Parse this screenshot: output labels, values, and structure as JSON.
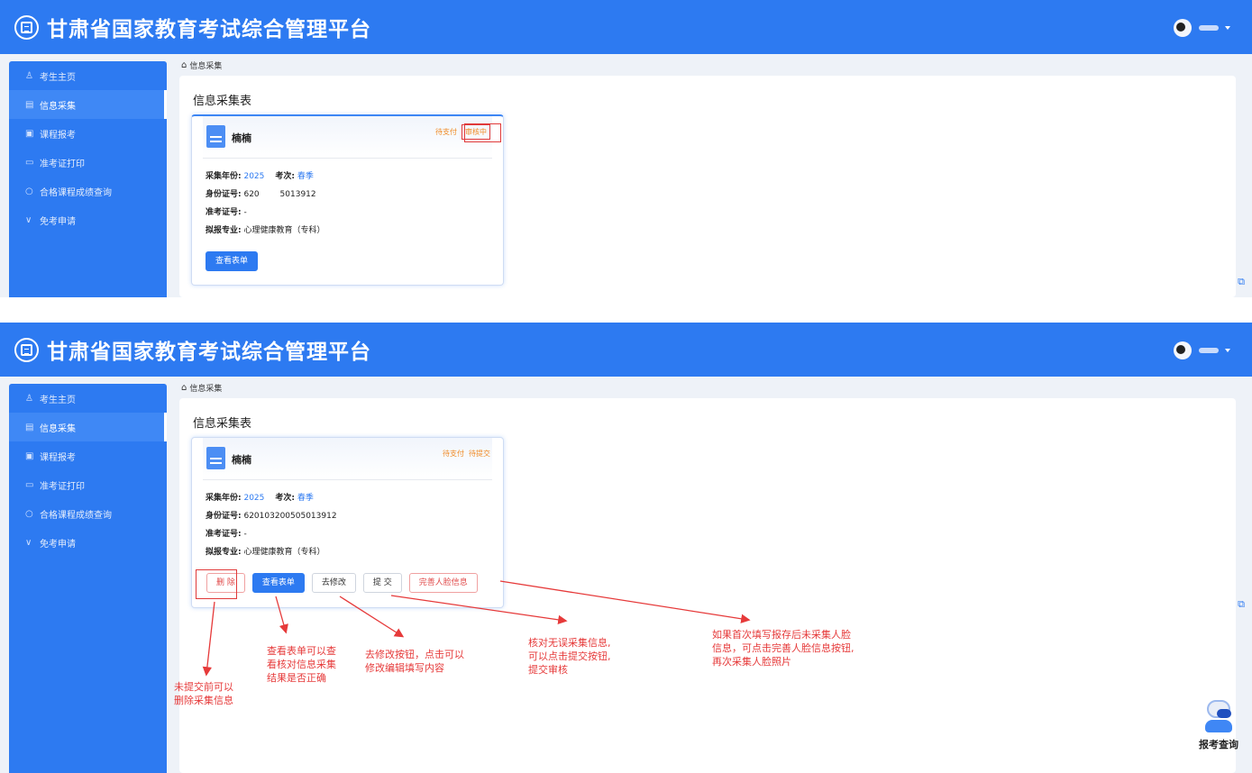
{
  "app": {
    "title": "甘肃省国家教育考试综合管理平台"
  },
  "nav": [
    {
      "icon": "user-icon",
      "label": "考生主页"
    },
    {
      "icon": "form-icon",
      "label": "信息采集"
    },
    {
      "icon": "course-icon",
      "label": "课程报考"
    },
    {
      "icon": "ticket-icon",
      "label": "准考证打印"
    },
    {
      "icon": "search-icon",
      "label": "合格课程成绩查询"
    },
    {
      "icon": "exempt-icon",
      "label": "免考申请"
    }
  ],
  "breadcrumb": "信息采集",
  "page_title": "信息采集表",
  "card": {
    "name": "楠楠",
    "year_label": "采集年份:",
    "year": "2025",
    "session_label": "考次:",
    "session": "春季",
    "id_label": "身份证号:",
    "id_top": "620        5013912",
    "id_bottom": "620103200505013912",
    "exam_no_label": "准考证号:",
    "exam_no": "-",
    "major_label": "拟报专业:",
    "major": "心理健康教育（专科）"
  },
  "screen_top": {
    "status_pay": "待支付",
    "status_review": "审核中"
  },
  "screen_bottom": {
    "status_pay": "待支付",
    "status_submit": "待提交"
  },
  "buttons": {
    "delete": "删 除",
    "view": "查看表单",
    "edit": "去修改",
    "submit": "提 交",
    "face": "完善人脸信息"
  },
  "annotations": {
    "delete": [
      "未提交前可以",
      "删除采集信息"
    ],
    "view": [
      "查看表单可以查",
      "看核对信息采集",
      "结果是否正确"
    ],
    "edit": [
      "去修改按钮，点击可以",
      "修改编辑填写内容"
    ],
    "submit": [
      "核对无误采集信息,",
      "可以点击提交按钮,",
      "提交审核"
    ],
    "face": [
      "如果首次填写报存后未采集人脸",
      "信息，可点击完善人脸信息按钮,",
      "再次采集人脸照片"
    ]
  },
  "robot_label": "报考查询",
  "colors": {
    "header": "#2d7af1",
    "accent": "#2d7af1",
    "status_orange": "#f08a24",
    "annotation_red": "#e63a3a"
  }
}
